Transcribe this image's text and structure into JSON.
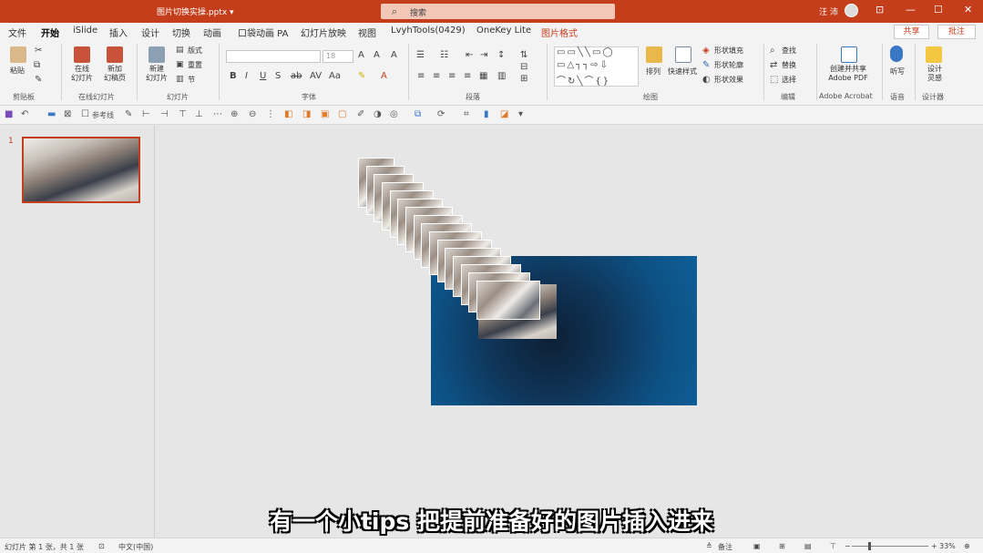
{
  "title_bar": {
    "doc_title": "图片切换实操.pptx ▾",
    "search_placeholder": "搜索",
    "user_name": "汪 沛",
    "window_buttons": [
      "⊡",
      "—",
      "☐",
      "✕"
    ]
  },
  "ribbon_tabs": [
    "文件",
    "开始",
    "iSlide",
    "插入",
    "设计",
    "切换",
    "动画",
    "口袋动画 PA",
    "幻灯片放映",
    "视图",
    "LvyhTools(0429)",
    "OneKey Lite",
    "图片格式"
  ],
  "active_tab": "开始",
  "share_label": "共享",
  "comment_label": "批注",
  "groups": {
    "clipboard": {
      "label": "剪贴板",
      "paste": "粘贴"
    },
    "online_slides": {
      "label": "在线幻灯片",
      "online": "在线\n幻灯片",
      "new_page": "新加\n幻稿页"
    },
    "slides": {
      "label": "幻灯片",
      "new_slide": "新建\n幻灯片",
      "layout": "版式",
      "reset": "重置",
      "section": "节"
    },
    "font": {
      "label": "字体",
      "font_size": "18"
    },
    "paragraph": {
      "label": "段落"
    },
    "drawing": {
      "label": "绘图",
      "arrange": "排列",
      "quick_styles": "快速样式",
      "fill": "形状填充",
      "outline": "形状轮廓",
      "effects": "形状效果"
    },
    "editing": {
      "label": "编辑",
      "find": "查找",
      "replace": "替换",
      "select": "选择"
    },
    "acrobat": {
      "label": "Adobe Acrobat",
      "create": "创建并共享\nAdobe PDF"
    },
    "voice": {
      "label": "语音",
      "dictate": "听写"
    },
    "designer": {
      "label": "设计器",
      "ideas": "设计\n灵感"
    }
  },
  "qat": {
    "reference_line": "参考线"
  },
  "thumbnail": {
    "slide_number": "1"
  },
  "subtitle": "有一个小tips 把提前准备好的图片插入进来",
  "status": {
    "slide_info": "幻灯片 第 1 张，共 1 张",
    "language": "中文(中国)",
    "notes": "备注",
    "zoom": "33%"
  },
  "colors": {
    "accent": "#c43e1c",
    "slide_bg": "#0e5f98"
  }
}
